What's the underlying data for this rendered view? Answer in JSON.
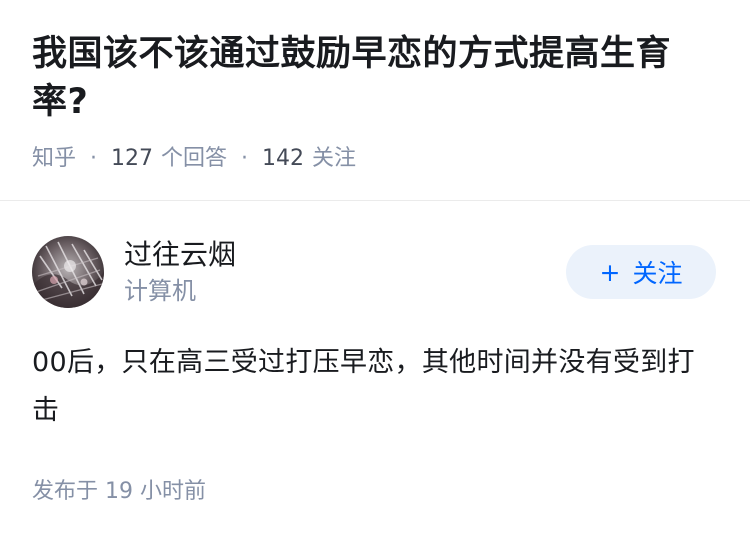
{
  "question": {
    "title": "我国该不该通过鼓励早恋的方式提高生育率?",
    "source": "知乎",
    "answer_count": "127",
    "answer_label": "个回答",
    "follower_count": "142",
    "follower_label": "关注",
    "separator": "·"
  },
  "answer": {
    "author": {
      "name": "过往云烟",
      "bio": "计算机",
      "avatar_icon": "avatar-image"
    },
    "follow": {
      "plus": "+",
      "label": "关注"
    },
    "content": "00后，只在高三受过打压早恋，其他时间并没有受到打击",
    "published": "发布于 19 小时前"
  },
  "colors": {
    "title": "#191b1f",
    "meta": "#8590a6",
    "accent": "#0066ff",
    "follow_bg": "#ebf2fb"
  }
}
